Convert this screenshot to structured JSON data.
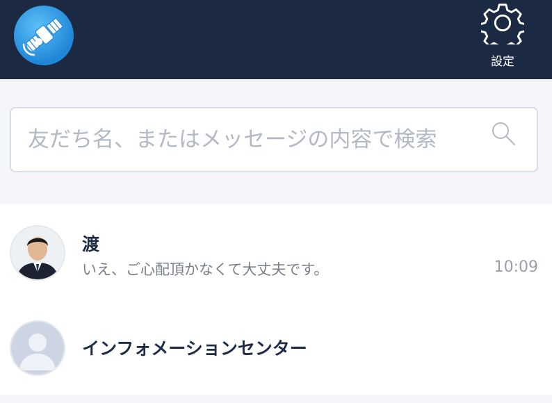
{
  "header": {
    "logo_icon": "satellite-icon",
    "settings": {
      "icon": "gear-icon",
      "label": "設定"
    }
  },
  "search": {
    "placeholder": "友だち名、またはメッセージの内容で検索",
    "icon": "search-icon"
  },
  "chats": [
    {
      "name": "渡",
      "preview": "いえ、ご心配頂かなくて大丈夫です。",
      "time": "10:09",
      "avatar": "user-photo"
    },
    {
      "name": "インフォメーションセンター",
      "preview": "",
      "time": "",
      "avatar": "default-avatar-icon"
    }
  ],
  "colors": {
    "header_bg": "#1b2a42",
    "page_bg": "#f4f6f9",
    "name_text": "#1e2c45",
    "preview_text": "#7a808a"
  }
}
